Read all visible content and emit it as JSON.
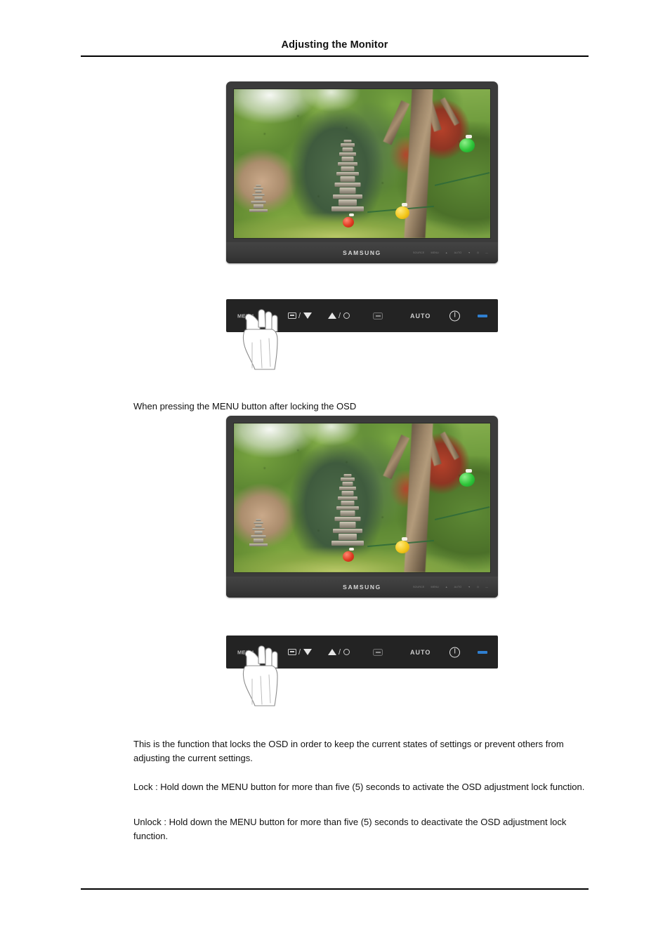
{
  "page": {
    "header_title": "Adjusting the Monitor"
  },
  "figure_one": {
    "name": "monitor-normal-display",
    "brand": "SAMSUNG",
    "bezel_keys": [
      "SOURCE",
      "MENU",
      "▲",
      "AUTO",
      "▼",
      "⏻",
      "—"
    ],
    "screen_description": "Korean garden photograph with stone pagoda, trees and paper lanterns"
  },
  "figure_two": {
    "name": "monitor-osd-locked-display",
    "brand": "SAMSUNG",
    "bezel_keys": [
      "SOURCE",
      "MENU",
      "▲",
      "AUTO",
      "▼",
      "⏻",
      "—"
    ],
    "screen_description": "Korean garden photograph with stone pagoda, trees and paper lanterns"
  },
  "control_panel": {
    "menu_label": "MENU",
    "source_label": "SOURCE",
    "down_label": "▼",
    "up_label": "▲",
    "brightness_label": "Brightness",
    "enter_label": "ENTER",
    "auto_label": "AUTO",
    "power_label": "Power",
    "led_label": "Power LED",
    "led_color": "#2f7fd0",
    "icons": {
      "source": "source-icon",
      "down": "triangle-down-icon",
      "up": "triangle-up-icon",
      "brightness": "sun-icon",
      "enter": "enter-icon",
      "power": "power-icon",
      "led": "led-indicator",
      "hand": "hand-pressing-icon"
    }
  },
  "content": {
    "lead_text": "When pressing the MENU button after locking the OSD",
    "paragraph_1": "This is the function that locks the OSD in order to keep the current states of settings or prevent others from adjusting the current settings.",
    "paragraph_2": "Lock : Hold down the MENU button for more than five (5) seconds to activate the OSD adjustment lock function.",
    "paragraph_3": "Unlock : Hold down the MENU button for more than five (5) seconds to deactivate the OSD adjustment lock function."
  }
}
